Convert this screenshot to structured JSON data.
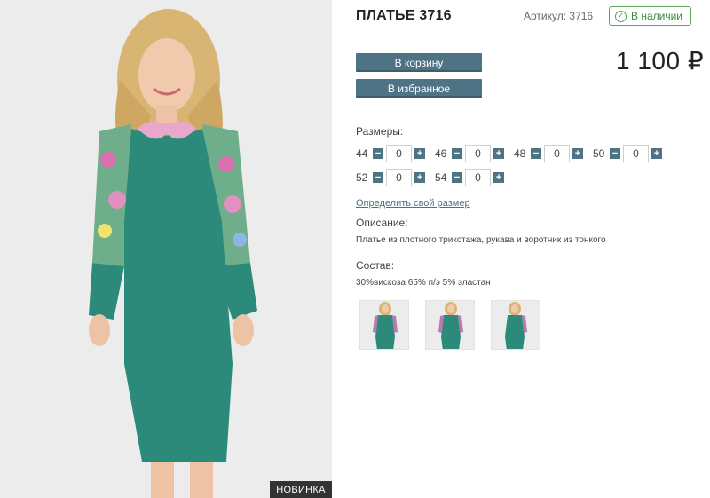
{
  "product": {
    "title": "ПЛАТЬЕ 3716",
    "sku_label": "Артикул: 3716",
    "stock_label": "В наличии",
    "price": "1 100 ₽",
    "badge": "НОВИНКА"
  },
  "actions": {
    "cart_label": "В корзину",
    "favorite_label": "В избранное"
  },
  "sizes": {
    "label": "Размеры:",
    "items": [
      {
        "size": "44",
        "qty": "0"
      },
      {
        "size": "46",
        "qty": "0"
      },
      {
        "size": "48",
        "qty": "0"
      },
      {
        "size": "50",
        "qty": "0"
      },
      {
        "size": "52",
        "qty": "0"
      },
      {
        "size": "54",
        "qty": "0"
      }
    ]
  },
  "size_link": "Определить свой размер",
  "description": {
    "label": "Описание:",
    "text": "Платье из плотного трикотажа, рукава и воротник из тонкого"
  },
  "composition": {
    "label": "Состав:",
    "text": "30%вискоза 65% п/э 5% эластан"
  },
  "colors": {
    "accent": "#4d7384",
    "stock_green": "#3d8b3d",
    "dress": "#2c8a7a"
  },
  "icons": {
    "stock": "check-circle-icon",
    "minus": "minus-icon",
    "plus": "plus-icon"
  }
}
